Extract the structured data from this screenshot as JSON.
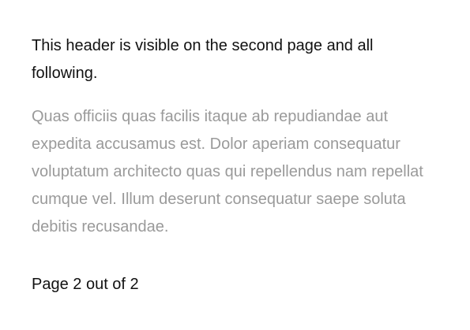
{
  "header": {
    "text": "This header is visible on the second page and all following."
  },
  "body": {
    "text": "Quas officiis quas facilis itaque ab repudiandae aut expedita accusamus est. Dolor aperiam consequatur voluptatum architecto quas qui repellendus nam repellat cumque vel. Illum deserunt consequatur saepe soluta debitis recusandae."
  },
  "footer": {
    "text": "Page 2 out of 2"
  },
  "colors": {
    "header_text": "#111111",
    "body_text": "#9a9a9a",
    "background": "#ffffff"
  }
}
